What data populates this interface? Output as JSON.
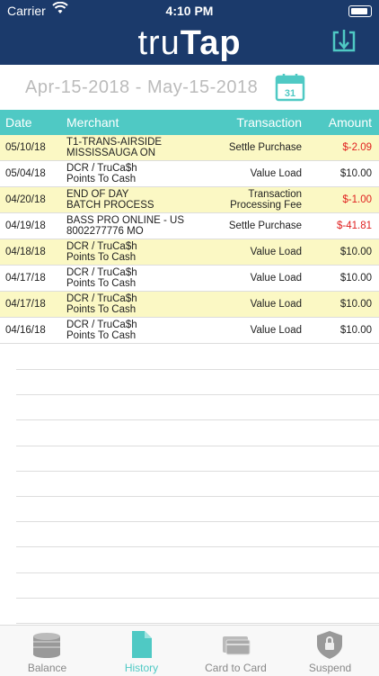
{
  "status": {
    "carrier": "Carrier",
    "time": "4:10 PM"
  },
  "header": {
    "logo_left": "tru",
    "logo_right": "Tap"
  },
  "daterange": {
    "text": "Apr-15-2018 - May-15-2018",
    "calendar_day": "31"
  },
  "table": {
    "headers": [
      "Date",
      "Merchant",
      "Transaction",
      "Amount"
    ],
    "rows": [
      {
        "date": "05/10/18",
        "merchant1": "T1-TRANS-AIRSIDE",
        "merchant2": "MISSISSAUGA ON",
        "trans1": "Settle Purchase",
        "trans2": "",
        "amount": "$-2.09",
        "negative": true,
        "highlight": true
      },
      {
        "date": "05/04/18",
        "merchant1": "DCR / TruCa$h",
        "merchant2": "Points To Cash",
        "trans1": "Value Load",
        "trans2": "",
        "amount": "$10.00",
        "negative": false,
        "highlight": false
      },
      {
        "date": "04/20/18",
        "merchant1": "END OF DAY",
        "merchant2": "BATCH PROCESS",
        "trans1": "Transaction",
        "trans2": "Processing Fee",
        "amount": "$-1.00",
        "negative": true,
        "highlight": true
      },
      {
        "date": "04/19/18",
        "merchant1": "BASS PRO ONLINE - US",
        "merchant2": "8002277776 MO",
        "trans1": "Settle Purchase",
        "trans2": "",
        "amount": "$-41.81",
        "negative": true,
        "highlight": false
      },
      {
        "date": "04/18/18",
        "merchant1": "DCR / TruCa$h",
        "merchant2": "Points To Cash",
        "trans1": "Value Load",
        "trans2": "",
        "amount": "$10.00",
        "negative": false,
        "highlight": true
      },
      {
        "date": "04/17/18",
        "merchant1": "DCR / TruCa$h",
        "merchant2": "Points To Cash",
        "trans1": "Value Load",
        "trans2": "",
        "amount": "$10.00",
        "negative": false,
        "highlight": false
      },
      {
        "date": "04/17/18",
        "merchant1": "DCR / TruCa$h",
        "merchant2": "Points To Cash",
        "trans1": "Value Load",
        "trans2": "",
        "amount": "$10.00",
        "negative": false,
        "highlight": true
      },
      {
        "date": "04/16/18",
        "merchant1": "DCR / TruCa$h",
        "merchant2": "Points To Cash",
        "trans1": "Value Load",
        "trans2": "",
        "amount": "$10.00",
        "negative": false,
        "highlight": false
      }
    ]
  },
  "tabs": [
    {
      "label": "Balance",
      "icon": "coins-icon"
    },
    {
      "label": "History",
      "icon": "document-icon"
    },
    {
      "label": "Card to Card",
      "icon": "cards-icon"
    },
    {
      "label": "Suspend",
      "icon": "shield-lock-icon"
    }
  ],
  "colors": {
    "navy": "#1b3a6b",
    "teal": "#4fc9c4",
    "highlight": "#fbf8c4",
    "negative": "#e02020"
  }
}
